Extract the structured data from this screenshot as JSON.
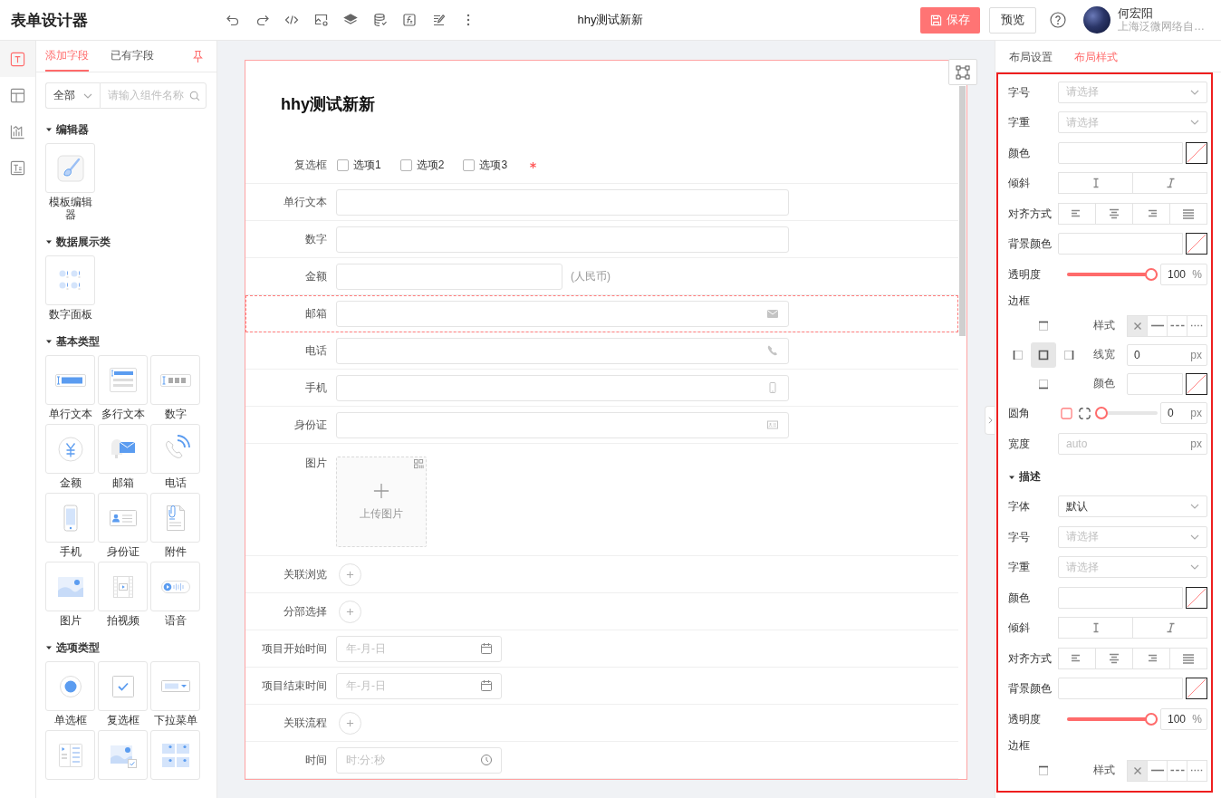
{
  "header": {
    "title": "表单设计器",
    "document_title": "hhy测试新新",
    "save": "保存",
    "preview": "预览",
    "user": {
      "name": "何宏阳",
      "org": "上海泛微网络自…"
    }
  },
  "rail": [
    {
      "selected": true
    },
    {
      "selected": false
    },
    {
      "selected": false
    },
    {
      "selected": false
    }
  ],
  "palette": {
    "tabs": [
      {
        "label": "添加字段",
        "selected": true
      },
      {
        "label": "已有字段",
        "selected": false
      }
    ],
    "filter": {
      "value": "全部",
      "placeholder": "请输入组件名称"
    },
    "groups": [
      {
        "title": "编辑器",
        "expanded": true,
        "items": [
          {
            "kind": "editor",
            "label": "模板编辑器"
          }
        ]
      },
      {
        "title": "数据展示类",
        "expanded": true,
        "items": [
          {
            "kind": "number-panel",
            "label": "数字面板"
          }
        ]
      },
      {
        "title": "基本类型",
        "expanded": true,
        "items": [
          {
            "kind": "text",
            "label": "单行文本"
          },
          {
            "kind": "textarea",
            "label": "多行文本"
          },
          {
            "kind": "number",
            "label": "数字"
          },
          {
            "kind": "money",
            "label": "金额"
          },
          {
            "kind": "email",
            "label": "邮箱"
          },
          {
            "kind": "phone",
            "label": "电话"
          },
          {
            "kind": "mobile",
            "label": "手机"
          },
          {
            "kind": "id-card",
            "label": "身份证"
          },
          {
            "kind": "attachment",
            "label": "附件"
          },
          {
            "kind": "image",
            "label": "图片"
          },
          {
            "kind": "video",
            "label": "拍视频"
          },
          {
            "kind": "voice",
            "label": "语音"
          }
        ]
      },
      {
        "title": "选项类型",
        "expanded": true,
        "items": [
          {
            "kind": "radio",
            "label": "单选框"
          },
          {
            "kind": "checkbox",
            "label": "复选框"
          },
          {
            "kind": "dropdown",
            "label": "下拉菜单"
          },
          {
            "kind": "list"
          },
          {
            "kind": "image-check"
          },
          {
            "kind": "image-grid"
          }
        ]
      }
    ]
  },
  "form": {
    "title": "hhy测试新新",
    "fields": [
      {
        "kind": "checkbox",
        "label": "复选框",
        "selected": false,
        "required": true,
        "options": [
          {
            "label": "选项1",
            "checked": false
          },
          {
            "label": "选项2",
            "checked": false
          },
          {
            "label": "选项3",
            "checked": false
          }
        ]
      },
      {
        "kind": "text",
        "label": "单行文本",
        "selected": false,
        "required": false
      },
      {
        "kind": "text",
        "label": "数字",
        "selected": false,
        "required": false
      },
      {
        "kind": "money",
        "label": "金额",
        "selected": false,
        "required": false,
        "unit": "(人民币)"
      },
      {
        "kind": "email",
        "label": "邮箱",
        "selected": true,
        "required": false
      },
      {
        "kind": "phone",
        "label": "电话",
        "selected": false,
        "required": false
      },
      {
        "kind": "mobile",
        "label": "手机",
        "selected": false,
        "required": false
      },
      {
        "kind": "id-card",
        "label": "身份证",
        "selected": false,
        "required": false
      },
      {
        "kind": "image",
        "label": "图片",
        "selected": false,
        "required": false,
        "button": "上传图片"
      },
      {
        "kind": "picker",
        "label": "关联浏览",
        "selected": false,
        "required": false
      },
      {
        "kind": "picker",
        "label": "分部选择",
        "selected": false,
        "required": false
      },
      {
        "kind": "date",
        "label": "项目开始时间",
        "selected": false,
        "required": false,
        "placeholder": "年-月-日"
      },
      {
        "kind": "date",
        "label": "项目结束时间",
        "selected": false,
        "required": false,
        "placeholder": "年-月-日"
      },
      {
        "kind": "picker",
        "label": "关联流程",
        "selected": false,
        "required": false
      },
      {
        "kind": "time",
        "label": "时间",
        "selected": false,
        "required": false,
        "placeholder": "时:分:秒"
      }
    ]
  },
  "properties": {
    "tabs": [
      {
        "label": "布局设置",
        "selected": false
      },
      {
        "label": "布局样式",
        "selected": true
      }
    ],
    "sections": [
      {
        "rows": [
          {
            "kind": "select",
            "label": "字号",
            "placeholder": "请选择"
          },
          {
            "kind": "select",
            "label": "字重",
            "placeholder": "请选择"
          },
          {
            "kind": "color",
            "label": "颜色"
          },
          {
            "kind": "toggle",
            "label": "倾斜",
            "options": [
              {
                "kind": "regular",
                "selected": false
              },
              {
                "kind": "italic",
                "selected": false
              }
            ]
          },
          {
            "kind": "toggle",
            "label": "对齐方式",
            "options": [
              {
                "kind": "left",
                "selected": false
              },
              {
                "kind": "center",
                "selected": false
              },
              {
                "kind": "right",
                "selected": false
              },
              {
                "kind": "justify",
                "selected": false
              }
            ]
          },
          {
            "kind": "color",
            "label": "背景颜色"
          },
          {
            "kind": "slider",
            "label": "透明度",
            "level": 1,
            "value": "100",
            "unit": "%"
          },
          {
            "kind": "border",
            "label": "边框",
            "sides": [
              {
                "kind": "top",
                "selected": false
              },
              {
                "kind": "left",
                "selected": false
              },
              {
                "kind": "all",
                "selected": true
              },
              {
                "kind": "right",
                "selected": false
              },
              {
                "kind": "bottom",
                "selected": false
              }
            ],
            "style": {
              "label": "样式",
              "options": [
                {
                  "kind": "none",
                  "selected": true
                },
                {
                  "kind": "solid",
                  "selected": false
                },
                {
                  "kind": "dashed",
                  "selected": false
                },
                {
                  "kind": "dotted",
                  "selected": false
                }
              ]
            },
            "width": {
              "label": "线宽",
              "value": "0",
              "unit": "px"
            },
            "color": {
              "label": "颜色"
            }
          },
          {
            "kind": "radius",
            "label": "圆角",
            "shapes": [
              {
                "kind": "square",
                "selected": true
              },
              {
                "kind": "corners",
                "selected": false
              }
            ],
            "level": 0,
            "value": "0",
            "unit": "px"
          },
          {
            "kind": "number",
            "label": "宽度",
            "placeholder": "auto",
            "unit": "px"
          }
        ]
      },
      {
        "title": "描述",
        "expanded": true,
        "rows": [
          {
            "kind": "select",
            "label": "字体",
            "value": "默认"
          },
          {
            "kind": "select",
            "label": "字号",
            "placeholder": "请选择"
          },
          {
            "kind": "select",
            "label": "字重",
            "placeholder": "请选择"
          },
          {
            "kind": "color",
            "label": "颜色"
          },
          {
            "kind": "toggle",
            "label": "倾斜",
            "options": [
              {
                "kind": "regular",
                "selected": false
              },
              {
                "kind": "italic",
                "selected": false
              }
            ]
          },
          {
            "kind": "toggle",
            "label": "对齐方式",
            "options": [
              {
                "kind": "left",
                "selected": false
              },
              {
                "kind": "center",
                "selected": false
              },
              {
                "kind": "right",
                "selected": false
              },
              {
                "kind": "justify",
                "selected": false
              }
            ]
          },
          {
            "kind": "color",
            "label": "背景颜色"
          },
          {
            "kind": "slider",
            "label": "透明度",
            "level": 1,
            "value": "100",
            "unit": "%"
          },
          {
            "kind": "border",
            "label": "边框",
            "sides": [
              {
                "kind": "top",
                "selected": false
              }
            ],
            "style": {
              "label": "样式",
              "options": [
                {
                  "kind": "none",
                  "selected": true
                },
                {
                  "kind": "solid",
                  "selected": false
                },
                {
                  "kind": "dashed",
                  "selected": false
                },
                {
                  "kind": "dotted",
                  "selected": false
                }
              ]
            }
          }
        ]
      }
    ]
  }
}
